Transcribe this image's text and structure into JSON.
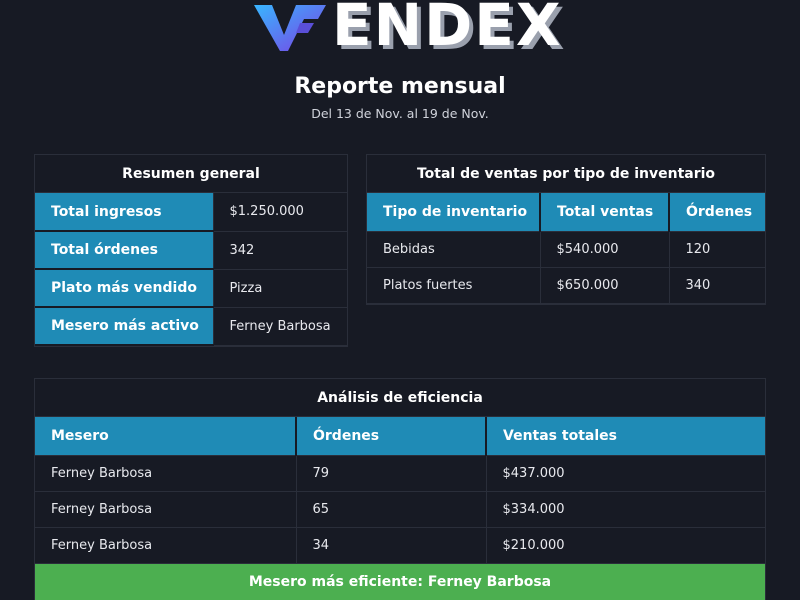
{
  "header": {
    "logo_text": "ENDEX",
    "title": "Reporte mensual",
    "subtitle": "Del 13 de Nov. al 19 de Nov."
  },
  "summary": {
    "title": "Resumen general",
    "rows": [
      {
        "label": "Total ingresos",
        "value": "$1.250.000"
      },
      {
        "label": "Total órdenes",
        "value": "342"
      },
      {
        "label": "Plato más vendido",
        "value": "Pizza"
      },
      {
        "label": "Mesero más activo",
        "value": "Ferney Barbosa"
      }
    ]
  },
  "inventory": {
    "title": "Total de ventas por tipo de inventario",
    "columns": [
      "Tipo de inventario",
      "Total ventas",
      "Órdenes"
    ],
    "rows": [
      [
        "Bebidas",
        "$540.000",
        "120"
      ],
      [
        "Platos fuertes",
        "$650.000",
        "340"
      ]
    ]
  },
  "efficiency": {
    "title": "Análisis de eficiencia",
    "columns": [
      "Mesero",
      "Órdenes",
      "Ventas totales"
    ],
    "rows": [
      [
        "Ferney Barbosa",
        "79",
        "$437.000"
      ],
      [
        "Ferney Barbosa",
        "65",
        "$334.000"
      ],
      [
        "Ferney Barbosa",
        "34",
        "$210.000"
      ]
    ],
    "footer": "Mesero más eficiente: Ferney Barbosa"
  },
  "colors": {
    "background": "#171a24",
    "header_cell": "#1f8bb6",
    "success_bar": "#4caf50"
  }
}
